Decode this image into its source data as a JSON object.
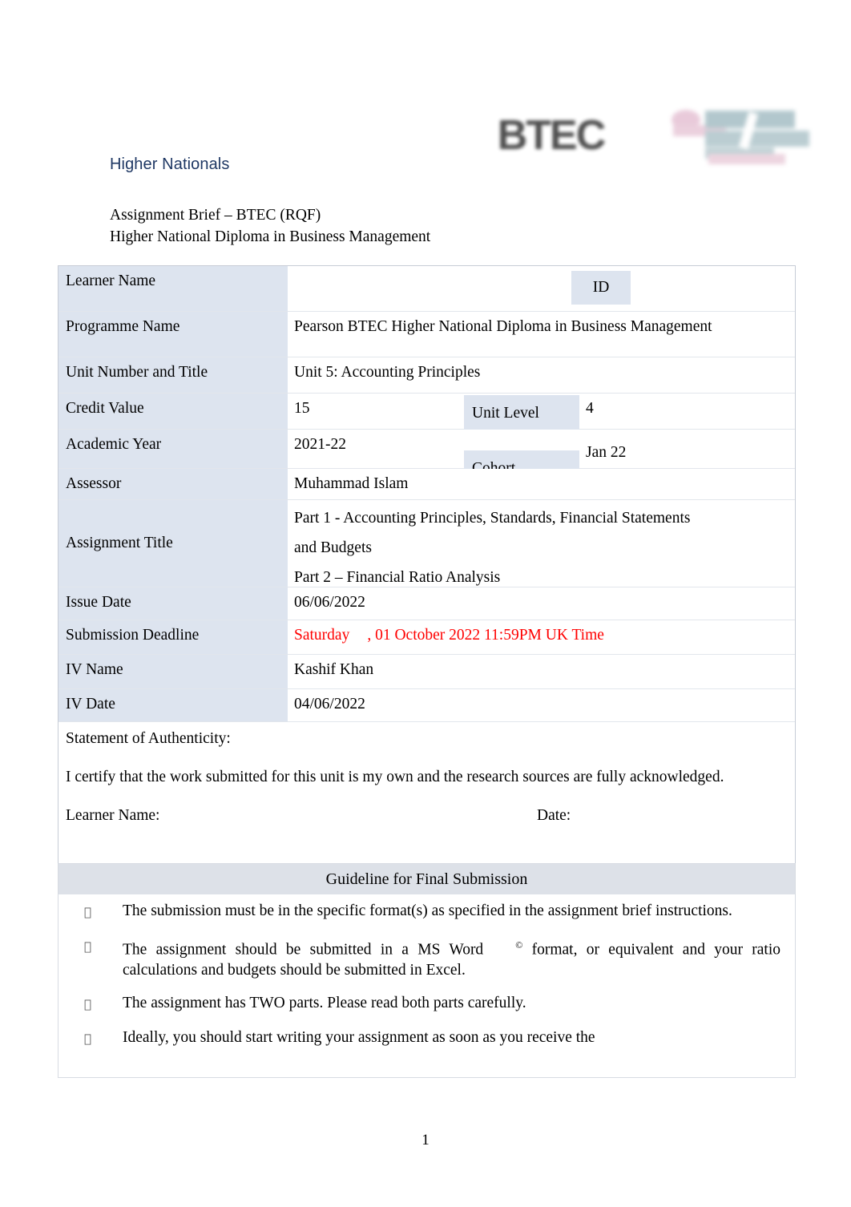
{
  "header": {
    "higher_nationals": "Higher Nationals",
    "assignment_brief": "Assignment Brief – BTEC (RQF)",
    "qualification": "Higher National Diploma in Business Management",
    "btec_logo_text": "BTEC"
  },
  "info_table": {
    "learner_name_label": "Learner Name",
    "learner_name_value": "",
    "id_label": "ID",
    "id_value": "",
    "programme_name_label": "Programme Name",
    "programme_name_value": "Pearson BTEC    Higher National Diploma in Business Management",
    "unit_number_label": "Unit Number and Title",
    "unit_number_value": "Unit 5: Accounting Principles",
    "credit_value_label": "Credit Value",
    "credit_value_value": "15",
    "unit_level_label": "Unit Level",
    "unit_level_value": "4",
    "academic_year_label": "Academic Year",
    "academic_year_value": "2021-22",
    "cohort_label": "Cohort",
    "cohort_value": "Jan 22",
    "assessor_label": "Assessor",
    "assessor_value": "Muhammad Islam",
    "assignment_title_label": "Assignment Title",
    "assignment_title_line1": "Part 1 - Accounting Principles, Standards, Financial Statements",
    "assignment_title_line2": "and Budgets",
    "assignment_title_line3": "Part 2 – Financial Ratio Analysis",
    "issue_date_label": "Issue Date",
    "issue_date_value": "06/06/2022",
    "submission_deadline_label": "Submission Deadline",
    "submission_deadline_day": "Saturday",
    "submission_deadline_rest": ", 01 October 2022 11:59PM UK Time",
    "iv_name_label": "IV Name",
    "iv_name_value": "Kashif Khan",
    "iv_date_label": "IV Date",
    "iv_date_value": "04/06/2022"
  },
  "authenticity": {
    "heading": "Statement of Authenticity:",
    "body": "I certify that the work submitted for this unit is my own and the research sources are fully acknowledged.",
    "learner_name_label": "Learner Name:",
    "date_label": "Date:"
  },
  "guideline": {
    "title": "Guideline for Final Submission",
    "bullet_marker": "",
    "items": [
      {
        "text": "The submission must be in the specific format(s) as specified in the assignment brief instructions."
      },
      {
        "text_part1": "The assignment should be submitted in a MS Word",
        "superscript": "©",
        "text_part2": "format, or equivalent and your ratio calculations and budgets should be submitted in Excel."
      },
      {
        "text": "The assignment has TWO parts. Please read both parts carefully."
      },
      {
        "text": "Ideally, you should start writing your assignment as soon as you receive the"
      }
    ]
  },
  "footer": {
    "page_number": "1"
  },
  "colors": {
    "heading_blue": "#1f3864",
    "label_cell_blue": "#dde4ef",
    "guideline_band": "#dde1e8",
    "deadline_red": "#ff0000"
  }
}
